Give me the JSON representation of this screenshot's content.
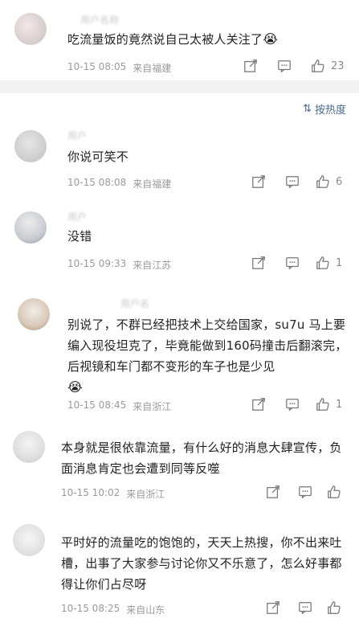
{
  "top": {
    "text": "吃流量饭的竟然说自己太被人关注了",
    "time": "10-15 08:05",
    "location": "来自福建",
    "likes": "23"
  },
  "sort": {
    "label": "按热度"
  },
  "comments": [
    {
      "text": "你说可笑不",
      "time": "10-15 08:08",
      "location": "来自福建",
      "likes": "6"
    },
    {
      "text": "没错",
      "time": "10-15 09:33",
      "location": "来自江苏",
      "likes": "1"
    },
    {
      "text": "别说了，不群已经把技术上交给国家，su7u 马上要编入现役坦克了，毕竟能做到160码撞击后翻滚完，后视镜和车门都不变形的车子也是少见",
      "time": "10-15 08:45",
      "location": "来自浙江",
      "likes": "1"
    },
    {
      "text": "本身就是很依靠流量，有什么好的消息大肆宣传，负面消息肯定也会遭到同等反噬",
      "time": "10-15 10:02",
      "location": "来自浙江",
      "likes": ""
    },
    {
      "text": "平时好的流量吃的饱饱的，天天上热搜，你不出来吐槽，出事了大家参与讨论你又不乐意了，怎么好事都得让你们占尽呀",
      "time": "10-15 08:25",
      "location": "来自山东",
      "likes": ""
    }
  ],
  "emoji": "😭"
}
